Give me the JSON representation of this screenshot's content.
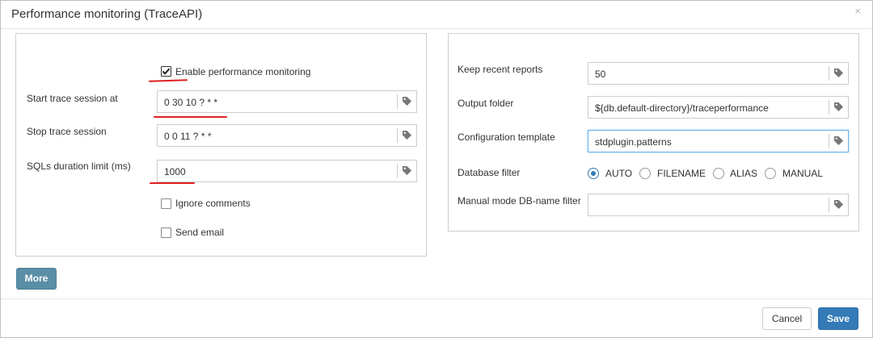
{
  "dialog": {
    "title": "Performance monitoring (TraceAPI)",
    "close_glyph": "×"
  },
  "left_panel": {
    "enable_monitoring": {
      "label": "Enable performance monitoring",
      "checked": true
    },
    "start_trace": {
      "label": "Start trace session at",
      "value": "0 30 10 ? * *"
    },
    "stop_trace": {
      "label": "Stop trace session",
      "value": "0 0 11 ? * *"
    },
    "sql_limit": {
      "label": "SQLs duration limit (ms)",
      "value": "1000"
    },
    "ignore_comments": {
      "label": "Ignore comments",
      "checked": false
    },
    "send_email": {
      "label": "Send email",
      "checked": false
    }
  },
  "right_panel": {
    "keep_reports": {
      "label": "Keep recent reports",
      "value": "50"
    },
    "output_folder": {
      "label": "Output folder",
      "value": "${db.default-directory}/traceperformance"
    },
    "config_template": {
      "label": "Configuration template",
      "value": "stdplugin.patterns"
    },
    "database_filter": {
      "label": "Database filter",
      "options": [
        "AUTO",
        "FILENAME",
        "ALIAS",
        "MANUAL"
      ],
      "selected": "AUTO"
    },
    "manual_db_filter": {
      "label": "Manual mode DB-name filter",
      "value": ""
    }
  },
  "buttons": {
    "more": "More",
    "cancel": "Cancel",
    "save": "Save"
  },
  "icons": {
    "tag": "tag-icon",
    "check": "checkmark-icon",
    "close": "close-icon"
  },
  "colors": {
    "primary": "#337ab7",
    "more_button": "#5a8ea6",
    "annotation": "#e02020"
  }
}
